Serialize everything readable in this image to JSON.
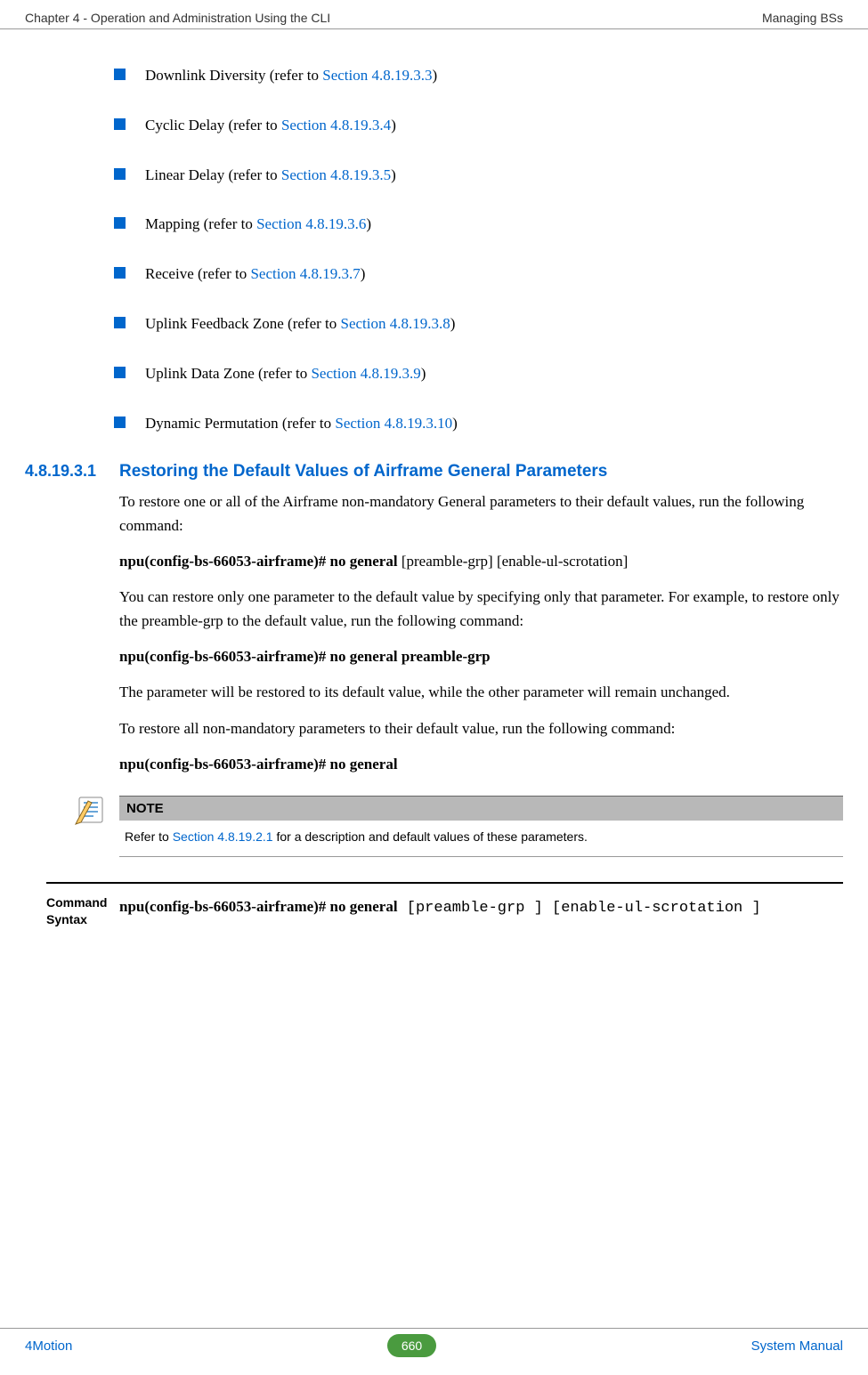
{
  "header": {
    "left": "Chapter 4 - Operation and Administration Using the CLI",
    "right": "Managing BSs"
  },
  "bullets": [
    {
      "prefix": "Downlink Diversity (refer to ",
      "link": "Section 4.8.19.3.3",
      "suffix": ")"
    },
    {
      "prefix": "Cyclic Delay (refer to ",
      "link": "Section 4.8.19.3.4",
      "suffix": ")"
    },
    {
      "prefix": "Linear Delay (refer to ",
      "link": "Section 4.8.19.3.5",
      "suffix": ")"
    },
    {
      "prefix": "Mapping (refer to ",
      "link": "Section 4.8.19.3.6",
      "suffix": ")"
    },
    {
      "prefix": "Receive (refer to ",
      "link": "Section 4.8.19.3.7",
      "suffix": ")"
    },
    {
      "prefix": "Uplink Feedback Zone (refer to ",
      "link": "Section 4.8.19.3.8",
      "suffix": ")"
    },
    {
      "prefix": "Uplink Data Zone (refer to ",
      "link": "Section 4.8.19.3.9",
      "suffix": ")"
    },
    {
      "prefix": "Dynamic Permutation (refer to ",
      "link": "Section 4.8.19.3.10",
      "suffix": ")"
    }
  ],
  "section": {
    "number": "4.8.19.3.1",
    "title": "Restoring the Default Values of Airframe General Parameters"
  },
  "paragraphs": {
    "p1": "To restore one or all of the Airframe non-mandatory General parameters to their default values, run the following command:",
    "cmd1_bold": "npu(config-bs-66053-airframe)# no general",
    "cmd1_tail": " [preamble-grp] [enable-ul-scrotation]",
    "p2": "You can restore only one parameter to the default value by specifying only that parameter. For example, to restore only the preamble-grp to the default value, run the following command:",
    "cmd2": "npu(config-bs-66053-airframe)# no general preamble-grp",
    "p3": "The parameter will be restored to its default value, while the other parameter will remain unchanged.",
    "p4": "To restore all non-mandatory parameters to their default value, run the following command:",
    "cmd3": "npu(config-bs-66053-airframe)# no general"
  },
  "note": {
    "label": "NOTE",
    "before": "Refer to ",
    "link": "Section 4.8.19.2.1",
    "after": " for a description and default values of these parameters."
  },
  "command_syntax": {
    "label": "Command Syntax",
    "bold": "npu(config-bs-66053-airframe)# no general",
    "mono": " [preamble-grp ] [enable-ul-scrotation ]"
  },
  "footer": {
    "left": "4Motion",
    "page": "660",
    "right": "System Manual"
  }
}
